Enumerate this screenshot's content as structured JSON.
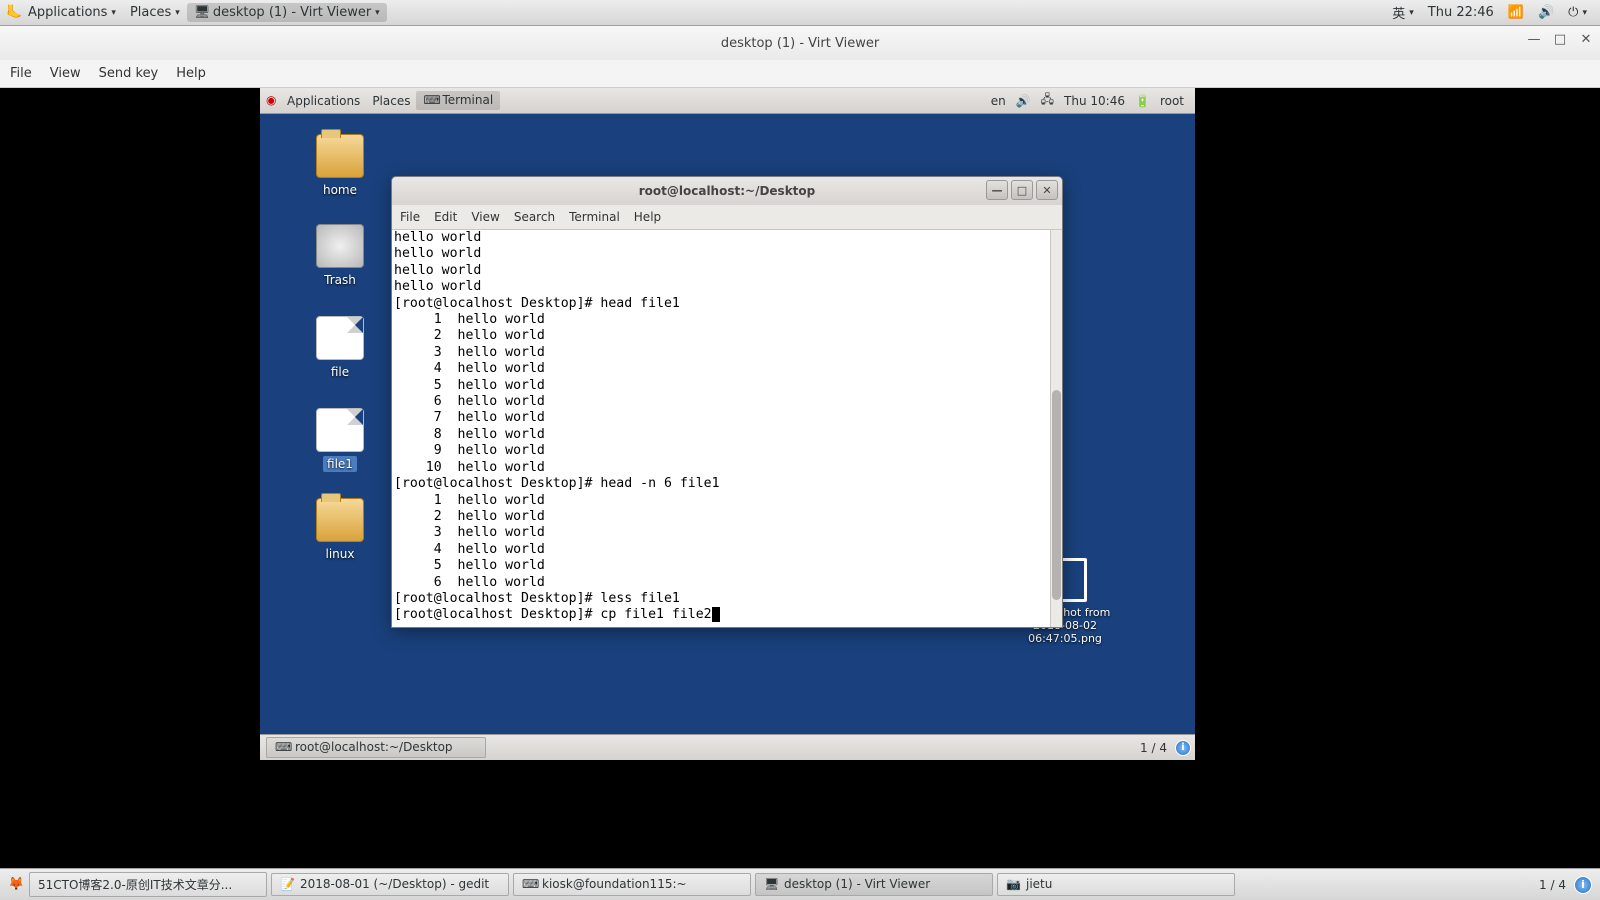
{
  "host_panel": {
    "applications": "Applications",
    "places": "Places",
    "task_label": "desktop (1) - Virt Viewer",
    "ime": "英",
    "clock": "Thu 22:46"
  },
  "virt_viewer": {
    "title": "desktop (1) - Virt Viewer",
    "menubar": [
      "File",
      "View",
      "Send key",
      "Help"
    ]
  },
  "guest_panel": {
    "applications": "Applications",
    "places": "Places",
    "task_label": "Terminal",
    "lang": "en",
    "clock": "Thu 10:46",
    "user": "root"
  },
  "desktop_icons": {
    "home": "home",
    "trash": "Trash",
    "file": "file",
    "file1": "file1",
    "linux": "linux"
  },
  "screenshot_label": "Screenshot from\n2018-08-02\n06:47:05.png",
  "terminal": {
    "title": "root@localhost:~/Desktop",
    "menubar": [
      "File",
      "Edit",
      "View",
      "Search",
      "Terminal",
      "Help"
    ],
    "lines": [
      "hello world",
      "hello world",
      "hello world",
      "hello world",
      "[root@localhost Desktop]# head file1",
      "     1  hello world",
      "     2  hello world",
      "     3  hello world",
      "     4  hello world",
      "     5  hello world",
      "     6  hello world",
      "     7  hello world",
      "     8  hello world",
      "     9  hello world",
      "    10  hello world",
      "[root@localhost Desktop]# head -n 6 file1",
      "     1  hello world",
      "     2  hello world",
      "     3  hello world",
      "     4  hello world",
      "     5  hello world",
      "     6  hello world",
      "[root@localhost Desktop]# less file1",
      "[root@localhost Desktop]# cp file1 file2"
    ]
  },
  "guest_bottom": {
    "task": "root@localhost:~/Desktop",
    "workspace": "1 / 4"
  },
  "host_bottom": {
    "tasks": [
      "51CTO博客2.0-原创IT技术文章分...",
      "2018-08-01 (~/Desktop) - gedit",
      "kiosk@foundation115:~",
      "desktop (1) - Virt Viewer",
      "jietu"
    ],
    "active_index": 3,
    "workspace": "1 / 4"
  }
}
